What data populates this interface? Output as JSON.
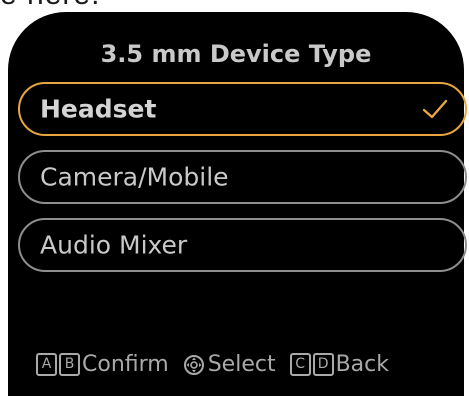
{
  "top_fragment": "e here.",
  "dialog": {
    "title": "3.5 mm Device Type"
  },
  "options": [
    {
      "label": "Headset",
      "selected": true
    },
    {
      "label": "Camera/Mobile",
      "selected": false
    },
    {
      "label": "Audio Mixer",
      "selected": false
    }
  ],
  "footer": {
    "confirm_keys": [
      "A",
      "B"
    ],
    "confirm_label": "Confirm",
    "select_icon": "joystick-icon",
    "select_label": "Select",
    "back_keys": [
      "C",
      "D"
    ],
    "back_label": "Back"
  },
  "colors": {
    "accent": "#e8a640",
    "text": "#c9c9c9",
    "border": "#8e8e8e",
    "background": "#000000"
  }
}
